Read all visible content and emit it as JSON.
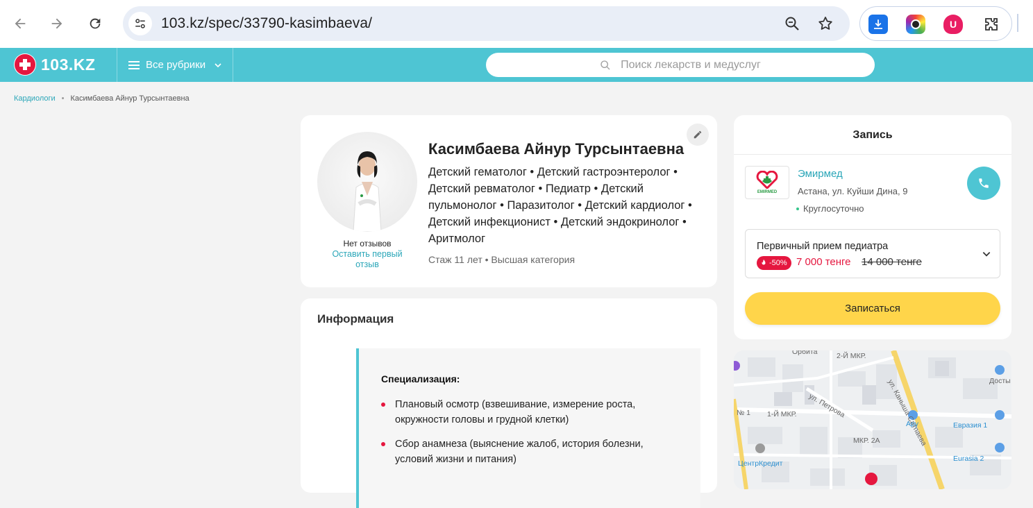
{
  "browser": {
    "url": "103.kz/spec/33790-kasimbaeva/"
  },
  "header": {
    "logo_text": "103.KZ",
    "rubrics_label": "Все рубрики",
    "search_placeholder": "Поиск лекарств и медуслуг"
  },
  "breadcrumb": {
    "parent": "Кардиологи",
    "current": "Касимбаева Айнур Турсынтаевна"
  },
  "profile": {
    "name": "Касимбаева Айнур Турсынтаевна",
    "specialties": "Детский гематолог • Детский гастроэнтеролог • Детский ревматолог • Педиатр • Детский пульмонолог • Паразитолог • Детский кардиолог • Детский инфекционист • Детский эндокринолог • Аритмолог",
    "meta": "Стаж 11 лет  •  Высшая категория",
    "no_reviews": "Нет отзывов",
    "leave_review": "Оставить первый отзыв"
  },
  "info": {
    "title": "Информация",
    "spec_title": "Специализация:",
    "items": [
      "Плановый осмотр (взвешивание, измерение роста, окружности головы и грудной клетки)",
      "Сбор анамнеза (выяснение жалоб, история болезни, условий жизни и питания)"
    ]
  },
  "booking": {
    "title": "Запись",
    "clinic_name": "Эмирмед",
    "clinic_logo_text": "EMIRMED",
    "clinic_address": "Астана, ул. Куйши Дина, 9",
    "clinic_hours": "Круглосуточно",
    "service_name": "Первичный прием педиатра",
    "discount": "-50%",
    "price_new": "7 000 тенге",
    "price_old": "14 000 тенге",
    "book_label": "Записаться"
  },
  "map": {
    "labels": [
      "Орбита",
      "2-Й МКР.",
      "ул. Каныша Сатпаева",
      "Досты",
      "ул. Петрова",
      "№ 1",
      "1-Й МКР.",
      "Ару",
      "Евразия 1",
      "МКР. 2А",
      "ЦентрКредит",
      "Eurasia 2"
    ]
  },
  "colors": {
    "brand": "#4ec5d3",
    "accent_red": "#e5173f",
    "button_yellow": "#ffd54a",
    "link": "#2aa6b8"
  }
}
